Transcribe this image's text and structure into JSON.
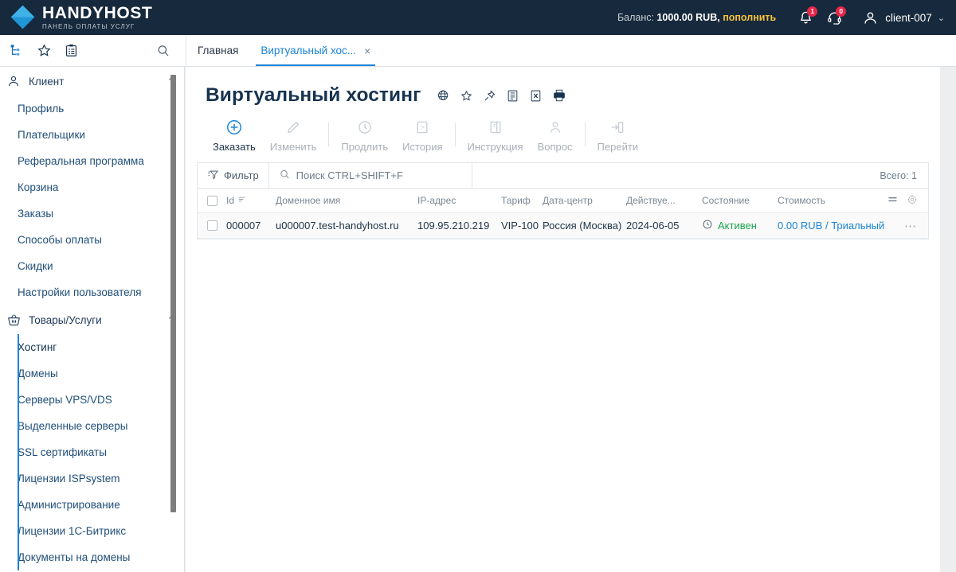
{
  "header": {
    "logo_name": "HANDYHOST",
    "logo_sub": "ПАНЕЛЬ ОПЛАТЫ УСЛУГ",
    "balance_label": "Баланс:",
    "balance_amount": "1000.00 RUB,",
    "balance_topup": "пополнить",
    "notifications": {
      "icon": "bell-icon",
      "count": "1"
    },
    "support": {
      "icon": "headset-icon",
      "count": "0"
    },
    "user": {
      "icon": "user-avatar-icon",
      "name": "client-007",
      "caret": "⌄"
    },
    "colors": {
      "background": "#17293c",
      "badge": "#e8264a",
      "topup": "#f5c33b"
    }
  },
  "toolbar_icons": {
    "tree": "tree-structure-icon",
    "favorite": "star-icon",
    "clipboard": "clipboard-icon",
    "search": "search-icon"
  },
  "tabs": [
    {
      "label": "Главная",
      "active": false,
      "closable": false
    },
    {
      "label": "Виртуальный хос...",
      "active": true,
      "closable": true,
      "close": "×"
    }
  ],
  "sidebar": {
    "groups": [
      {
        "label": "Клиент",
        "icon": "user-icon",
        "chevron": "⌃",
        "active": false,
        "items": [
          {
            "label": "Профиль"
          },
          {
            "label": "Плательщики"
          },
          {
            "label": "Реферальная программа"
          },
          {
            "label": "Корзина"
          },
          {
            "label": "Заказы"
          },
          {
            "label": "Способы оплаты"
          },
          {
            "label": "Скидки"
          },
          {
            "label": "Настройки пользователя"
          }
        ]
      },
      {
        "label": "Товары/Услуги",
        "icon": "basket-icon",
        "chevron": "⌃",
        "active": true,
        "items": [
          {
            "label": "Хостинг",
            "selected": true
          },
          {
            "label": "Домены"
          },
          {
            "label": "Серверы VPS/VDS"
          },
          {
            "label": "Выделенные серверы"
          },
          {
            "label": "SSL сертификаты"
          },
          {
            "label": "Лицензии ISPsystem"
          },
          {
            "label": "Администрирование"
          },
          {
            "label": "Лицензии 1С-Битрикс"
          },
          {
            "label": "Документы на домены"
          }
        ]
      }
    ]
  },
  "page": {
    "title": "Виртуальный хостинг",
    "title_icons": [
      {
        "name": "globe-icon"
      },
      {
        "name": "star-icon"
      },
      {
        "name": "pin-icon"
      },
      {
        "name": "report-icon"
      },
      {
        "name": "export-excel-icon"
      },
      {
        "name": "print-icon"
      }
    ],
    "actions": [
      {
        "label": "Заказать",
        "icon": "plus-circle-icon",
        "enabled": true
      },
      {
        "label": "Изменить",
        "icon": "pencil-icon",
        "enabled": false
      },
      {
        "sep": true
      },
      {
        "label": "Продлить",
        "icon": "clock-icon",
        "enabled": false
      },
      {
        "label": "История",
        "icon": "history-icon",
        "enabled": false
      },
      {
        "sep": true
      },
      {
        "label": "Инструкция",
        "icon": "manual-icon",
        "enabled": false
      },
      {
        "label": "Вопрос",
        "icon": "question-user-icon",
        "enabled": false
      },
      {
        "sep": true
      },
      {
        "label": "Перейти",
        "icon": "goto-icon",
        "enabled": false
      }
    ]
  },
  "filterbar": {
    "filter_label": "Фильтр",
    "filter_icon": "filter-icon",
    "search_icon": "search-icon",
    "search_placeholder": "Поиск CTRL+SHIFT+F",
    "search_value": "",
    "total_label": "Всего: 1"
  },
  "table": {
    "columns": [
      {
        "key": "id",
        "label": "Id",
        "sort_icon": "sort-icon"
      },
      {
        "key": "domain",
        "label": "Доменное имя"
      },
      {
        "key": "ip",
        "label": "IP-адрес"
      },
      {
        "key": "tariff",
        "label": "Тариф"
      },
      {
        "key": "dc",
        "label": "Дата-центр"
      },
      {
        "key": "valid",
        "label": "Действуе..."
      },
      {
        "key": "state",
        "label": "Состояние"
      },
      {
        "key": "cost",
        "label": "Стоимость"
      }
    ],
    "header_tools": [
      {
        "name": "list-view-icon"
      },
      {
        "name": "gear-icon"
      }
    ],
    "rows": [
      {
        "checked": false,
        "id": "000007",
        "domain": "u000007.test-handyhost.ru",
        "ip": "109.95.210.219",
        "tariff": "VIP-100",
        "dc": "Россия (Москва)",
        "valid": "2024-06-05",
        "state_icon": "clock-icon",
        "state": "Активен",
        "cost": "0.00 RUB / Триальный",
        "actions": "⋯"
      }
    ]
  },
  "colors": {
    "accent": "#1b84d6",
    "success": "#1aa54e",
    "header_bg": "#17293c",
    "page_bg": "#eceef0"
  }
}
